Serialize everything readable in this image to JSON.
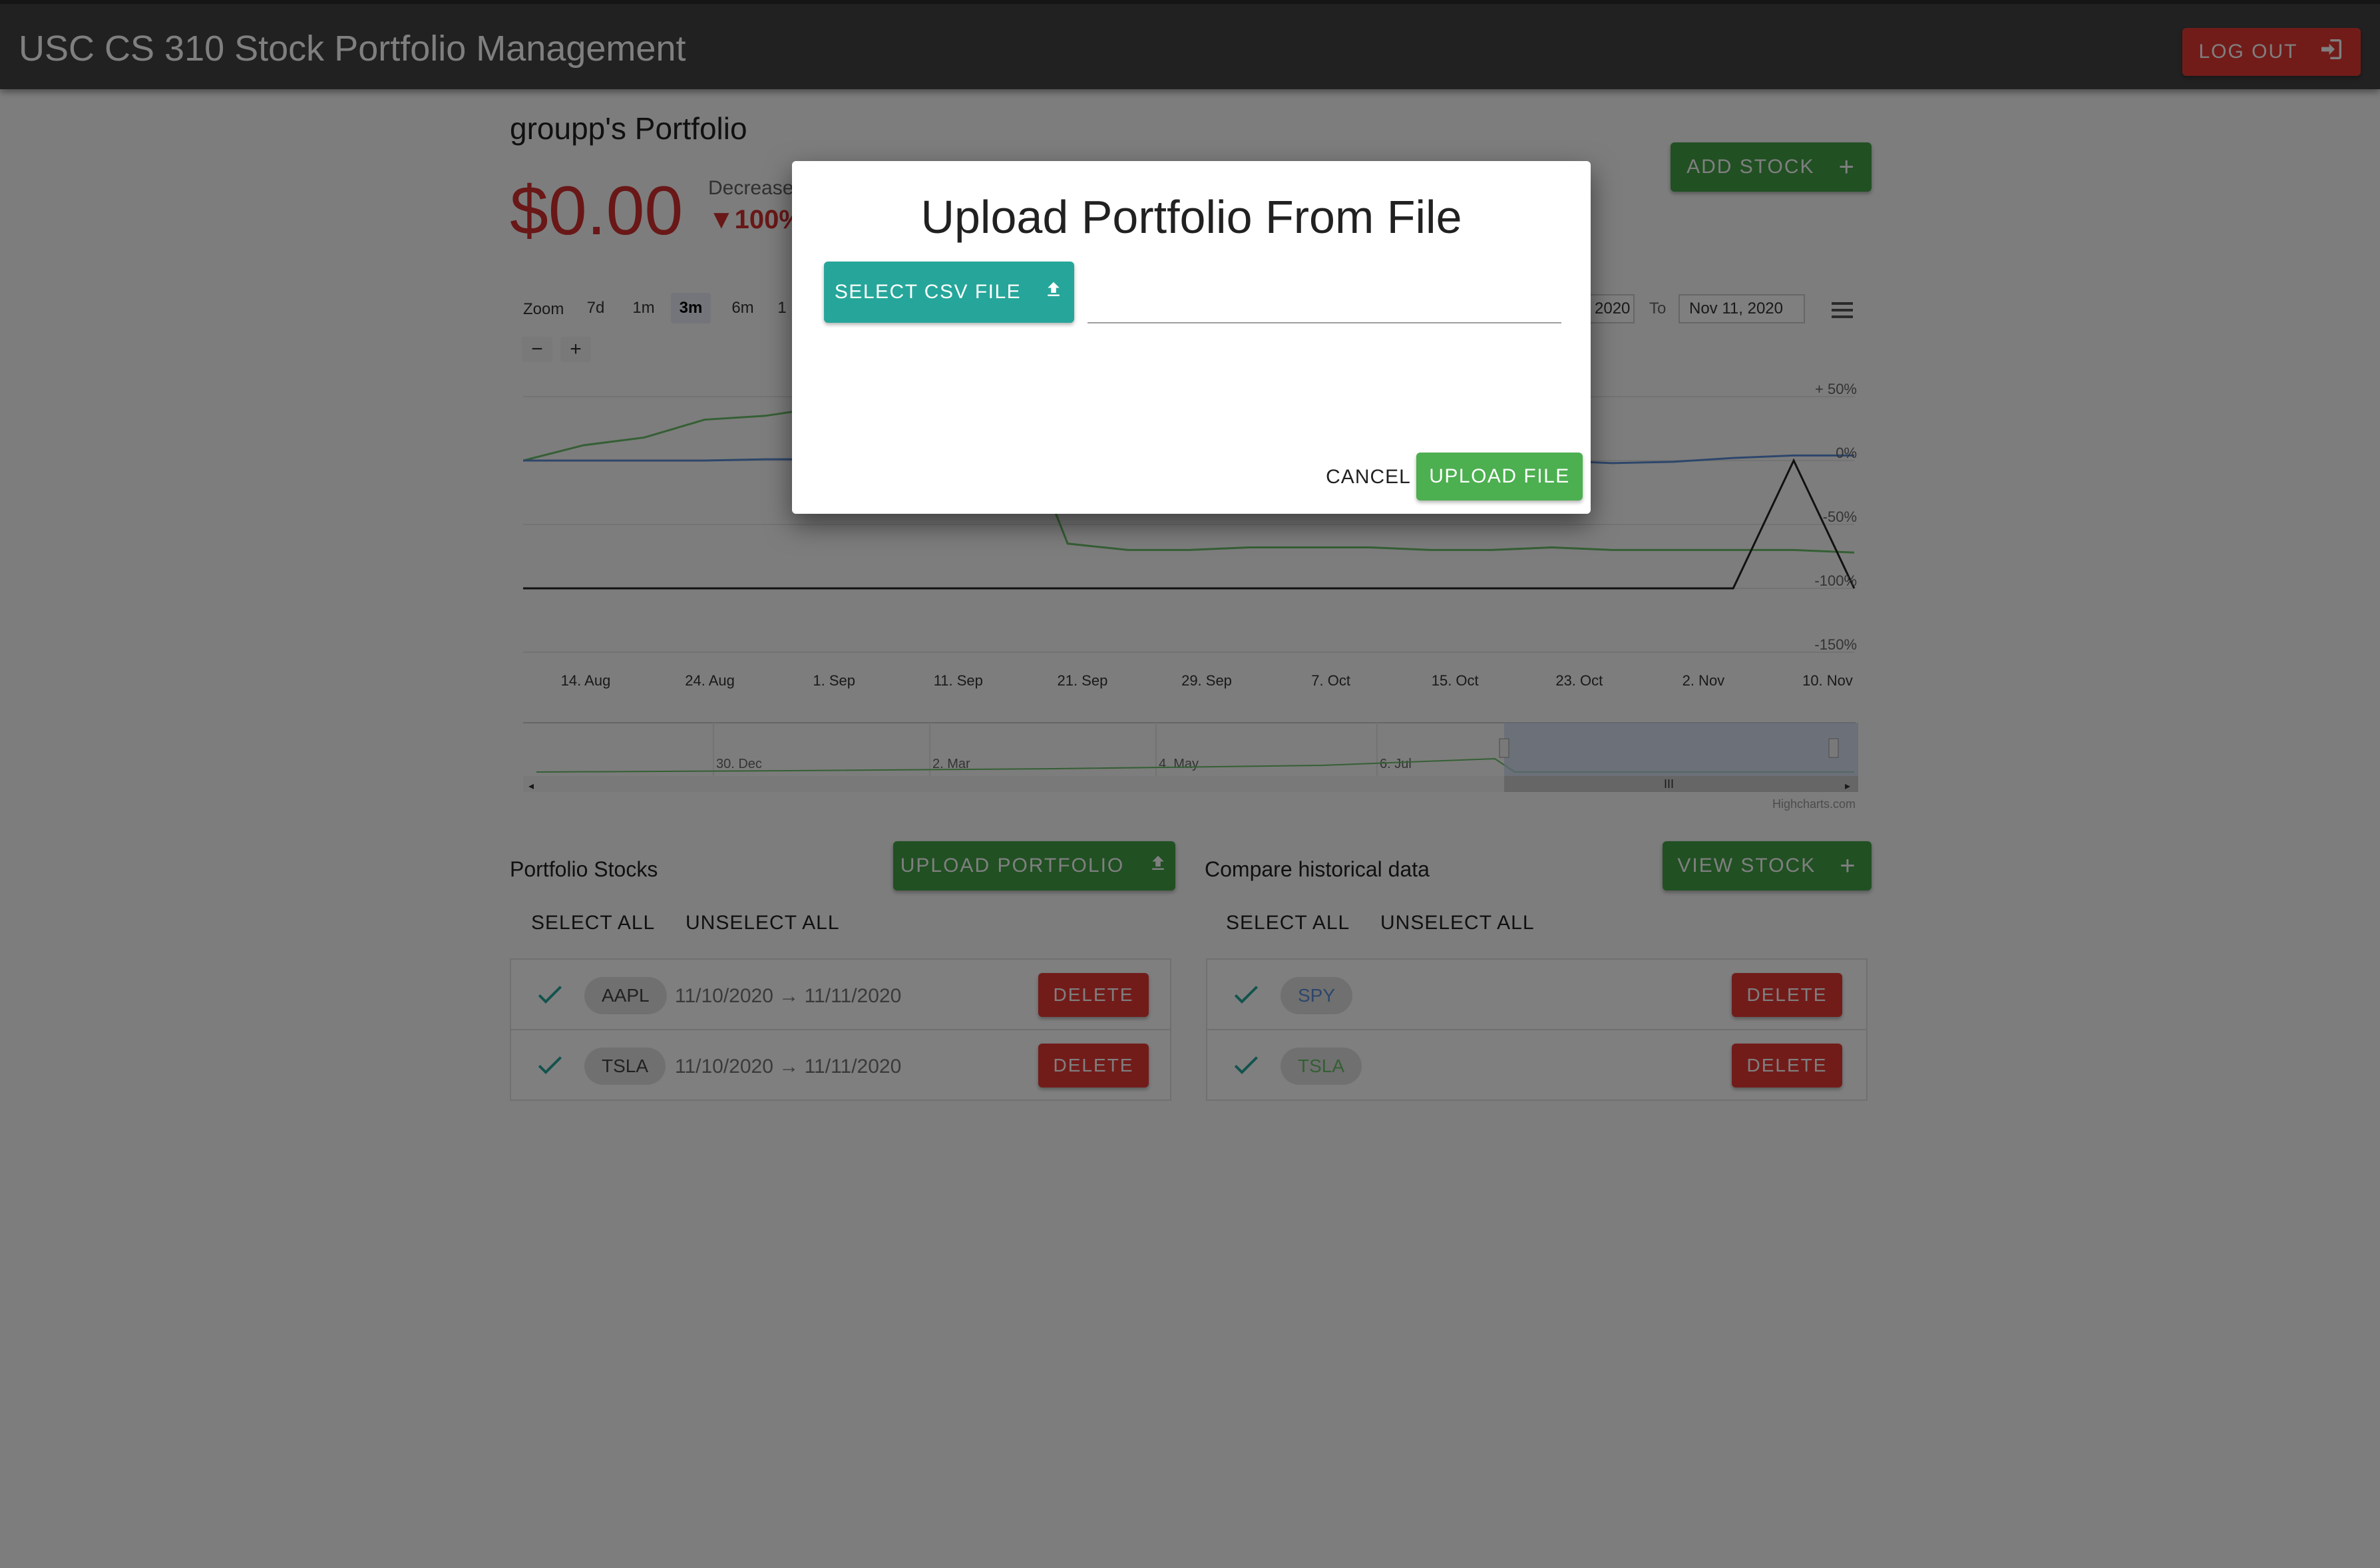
{
  "app": {
    "title": "USC CS 310 Stock Portfolio Management",
    "logout_label": "LOG OUT"
  },
  "portfolio": {
    "title": "groupp's Portfolio",
    "value": "$0.00",
    "change_label": "Decrease",
    "change_value": "▼100%",
    "add_stock_label": "ADD STOCK"
  },
  "chart": {
    "zoom_label": "Zoom",
    "zoom_options": [
      "7d",
      "1m",
      "3m",
      "6m",
      "1"
    ],
    "zoom_selected": "3m",
    "from_date_partial": "2020",
    "to_label": "To",
    "to_date": "Nov 11, 2020",
    "credits": "Highcharts.com"
  },
  "chart_data": {
    "type": "line",
    "x_ticks": [
      "14. Aug",
      "24. Aug",
      "1. Sep",
      "11. Sep",
      "21. Sep",
      "29. Sep",
      "7. Oct",
      "15. Oct",
      "23. Oct",
      "2. Nov",
      "10. Nov"
    ],
    "y_ticks": [
      "+ 50%",
      "0%",
      "-50%",
      "-100%",
      "-150%"
    ],
    "ylim": [
      -150,
      50
    ],
    "navigator_ticks": [
      "30. Dec",
      "2. Mar",
      "4. May",
      "6. Jul"
    ],
    "series": [
      {
        "color": "#6abf69",
        "values": [
          0,
          12,
          18,
          32,
          35,
          42,
          40,
          52,
          55,
          -65,
          -70,
          -70,
          -68,
          -68,
          -68,
          -70,
          -70,
          -68,
          -70,
          -70,
          -70,
          -70,
          -72
        ]
      },
      {
        "color": "#5b8dd6",
        "values": [
          0,
          0,
          0,
          0,
          1,
          1,
          2,
          2,
          3,
          3,
          2,
          1,
          2,
          3,
          2,
          1,
          1,
          0,
          -2,
          -1,
          2,
          4,
          4
        ]
      },
      {
        "color": "#222222",
        "values": [
          -100,
          -100,
          -100,
          -100,
          -100,
          -100,
          -100,
          -100,
          -100,
          -100,
          -100,
          -100,
          -100,
          -100,
          -100,
          -100,
          -100,
          -100,
          -100,
          -100,
          -100,
          0,
          -100
        ]
      }
    ]
  },
  "portfolio_stocks": {
    "title": "Portfolio Stocks",
    "upload_label": "UPLOAD PORTFOLIO",
    "select_all": "SELECT ALL",
    "unselect_all": "UNSELECT ALL",
    "items": [
      {
        "ticker": "AAPL",
        "range": "11/10/2020 → 11/11/2020",
        "delete": "DELETE"
      },
      {
        "ticker": "TSLA",
        "range": "11/10/2020 → 11/11/2020",
        "delete": "DELETE"
      }
    ]
  },
  "compare": {
    "title": "Compare historical data",
    "view_label": "VIEW STOCK",
    "select_all": "SELECT ALL",
    "unselect_all": "UNSELECT ALL",
    "items": [
      {
        "ticker": "SPY",
        "color": "#5b8dd6",
        "delete": "DELETE"
      },
      {
        "ticker": "TSLA",
        "color": "#6abf69",
        "delete": "DELETE"
      }
    ]
  },
  "dialog": {
    "title": "Upload Portfolio From File",
    "select_label": "SELECT CSV FILE",
    "file_value": "",
    "cancel_label": "CANCEL",
    "upload_label": "UPLOAD FILE"
  },
  "colors": {
    "app_bar": "#424242",
    "danger": "#e53935",
    "success": "#43a047",
    "teal": "#26a69a"
  }
}
